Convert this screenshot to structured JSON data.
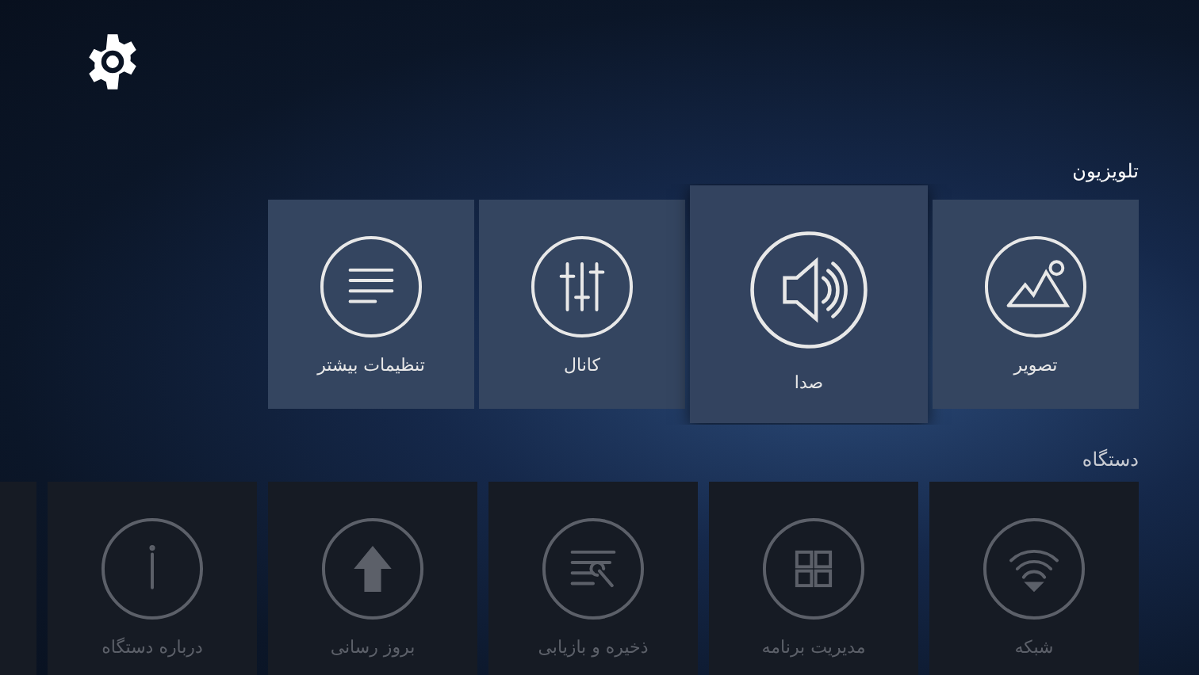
{
  "sections": [
    {
      "title": "تلویزیون",
      "dimmed": false,
      "tiles": [
        {
          "label": "تصویر",
          "kind": "picture",
          "selected": false
        },
        {
          "label": "صدا",
          "kind": "sound",
          "selected": true
        },
        {
          "label": "کانال",
          "kind": "channel",
          "selected": false
        },
        {
          "label": "تنظیمات بیشتر",
          "kind": "more",
          "selected": false
        }
      ]
    },
    {
      "title": "دستگاه",
      "dimmed": true,
      "tiles": [
        {
          "label": "شبکه",
          "kind": "network",
          "selected": false
        },
        {
          "label": "مدیریت برنامه",
          "kind": "apps",
          "selected": false
        },
        {
          "label": "ذخیره و بازیابی",
          "kind": "backup",
          "selected": false
        },
        {
          "label": "بروز رسانی",
          "kind": "update",
          "selected": false
        },
        {
          "label": "درباره دستگاه",
          "kind": "about",
          "selected": false
        }
      ]
    }
  ]
}
